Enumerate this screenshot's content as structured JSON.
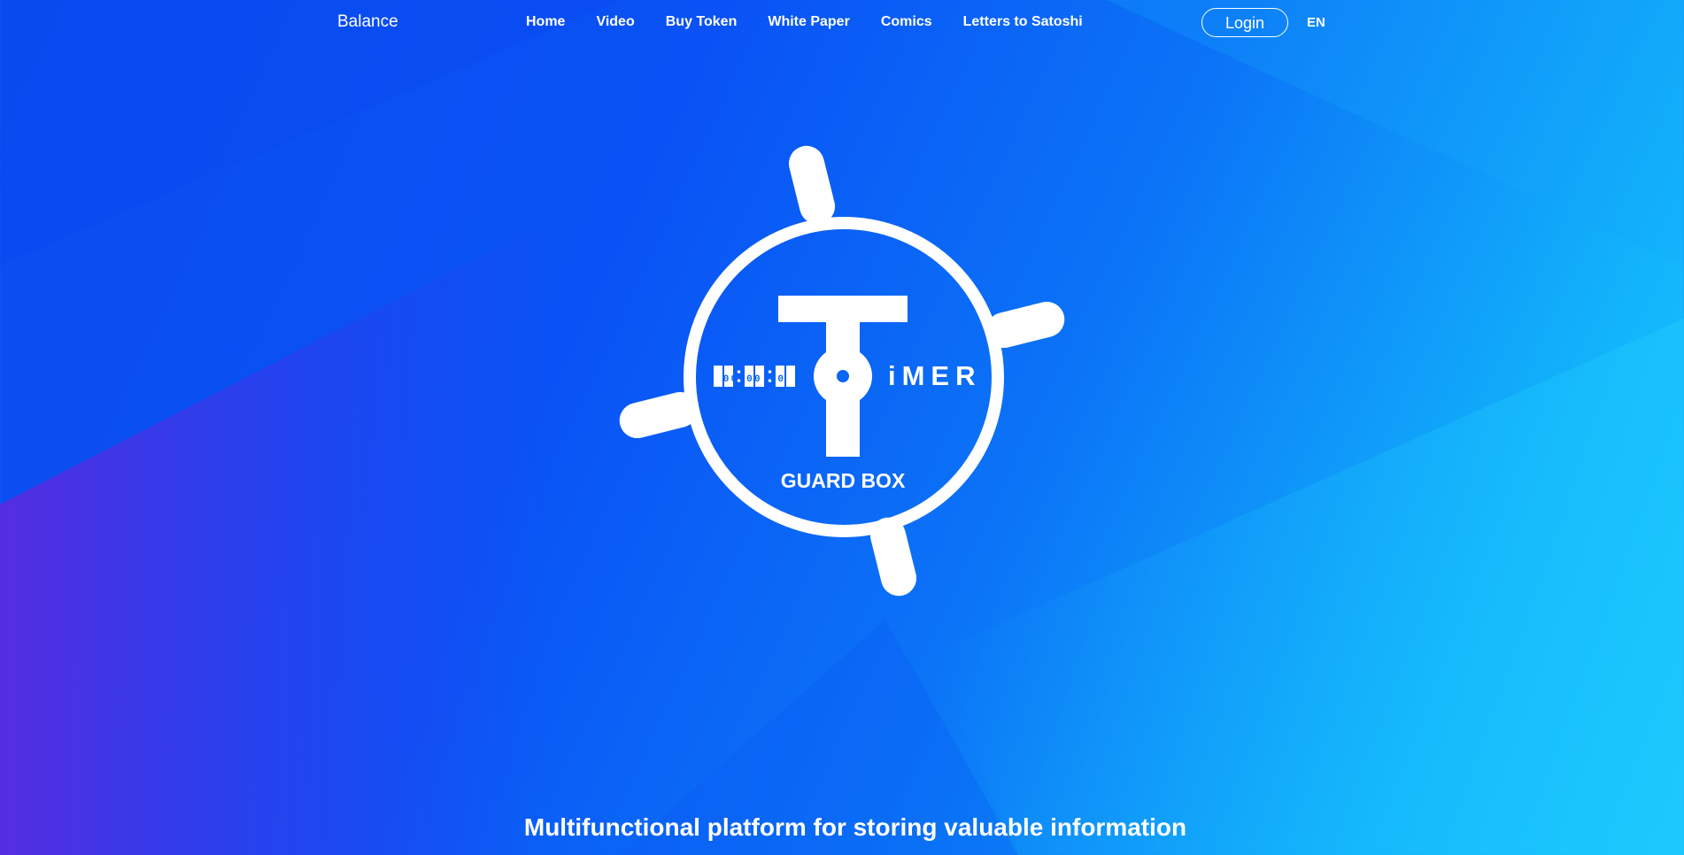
{
  "header": {
    "brand": "Balance",
    "nav": [
      "Home",
      "Video",
      "Buy Token",
      "White Paper",
      "Comics",
      "Letters to Satoshi"
    ],
    "login_label": "Login",
    "language": "EN"
  },
  "logo": {
    "timer_digits": "00:00:00",
    "imer_text": "iMER",
    "subtitle": "GUARD BOX"
  },
  "hero": {
    "tagline": "Multifunctional platform for storing valuable information"
  },
  "colors": {
    "background_left": "#0a4cf0",
    "background_right": "#1cc9fd",
    "accent_purple": "#5a2be0",
    "logo_white": "#ffffff",
    "logo_blue": "#0a66f5"
  }
}
